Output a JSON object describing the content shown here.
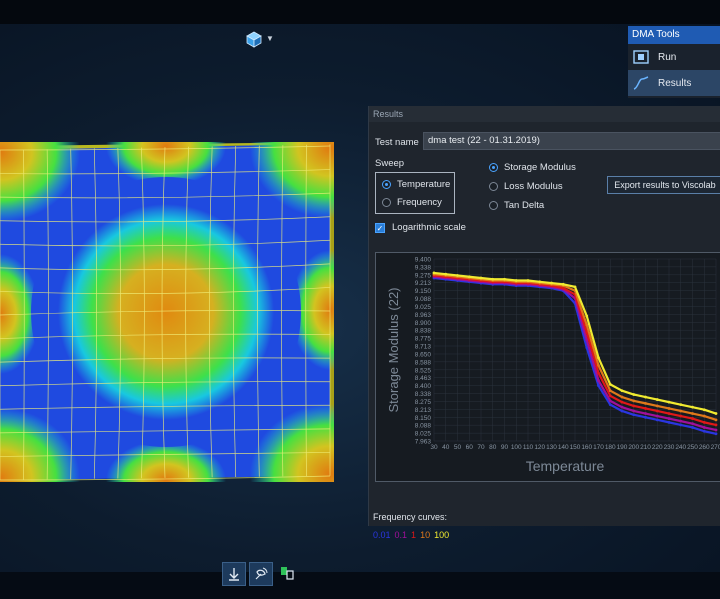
{
  "tools": {
    "title": "DMA Tools",
    "items": [
      {
        "label": "Run",
        "icon": "run-icon"
      },
      {
        "label": "Results",
        "icon": "results-curve-icon"
      }
    ]
  },
  "results": {
    "header": "Results",
    "test_name_label": "Test name",
    "test_name_value": "dma test (22 - 01.31.2019)",
    "sweep_label": "Sweep",
    "sweep_options": [
      "Temperature",
      "Frequency"
    ],
    "sweep_selected": "Temperature",
    "measure_options": [
      "Storage Modulus",
      "Loss Modulus",
      "Tan Delta"
    ],
    "measure_selected": "Storage Modulus",
    "export_label": "Export results to Viscolab",
    "log_scale_label": "Logarithmic scale",
    "log_scale_checked": true,
    "frequency_curves_label": "Frequency curves:",
    "frequency_values": [
      "0.01",
      "0.1",
      "1",
      "10",
      "100"
    ],
    "frequency_colors": [
      "#2a36e0",
      "#a0109a",
      "#e01818",
      "#e0781a",
      "#f0ea30"
    ]
  },
  "chart_data": {
    "type": "line",
    "xlabel": "Temperature",
    "ylabel": "Storage Modulus (22)",
    "x": [
      30,
      40,
      50,
      60,
      70,
      80,
      90,
      100,
      110,
      120,
      130,
      140,
      150,
      160,
      170,
      180,
      190,
      200,
      210,
      220,
      230,
      240,
      250,
      260,
      270
    ],
    "ylim": [
      7.963,
      9.4
    ],
    "yticks": [
      "9.400",
      "9.338",
      "9.275",
      "9.213",
      "9.150",
      "9.088",
      "9.025",
      "8.963",
      "8.900",
      "8.838",
      "8.775",
      "8.713",
      "8.650",
      "8.588",
      "8.525",
      "8.463",
      "8.400",
      "8.338",
      "8.275",
      "8.213",
      "8.150",
      "8.088",
      "8.025",
      "7.963"
    ],
    "series": [
      {
        "name": "0.01",
        "color": "#2a36e0",
        "values": [
          9.25,
          9.24,
          9.23,
          9.22,
          9.21,
          9.2,
          9.2,
          9.19,
          9.19,
          9.18,
          9.17,
          9.15,
          9.05,
          8.7,
          8.4,
          8.25,
          8.2,
          8.17,
          8.15,
          8.13,
          8.11,
          8.09,
          8.07,
          8.04,
          8.02
        ]
      },
      {
        "name": "0.1",
        "color": "#a0109a",
        "values": [
          9.26,
          9.25,
          9.24,
          9.23,
          9.22,
          9.21,
          9.21,
          9.2,
          9.2,
          9.19,
          9.18,
          9.16,
          9.09,
          8.76,
          8.44,
          8.28,
          8.23,
          8.2,
          8.18,
          8.16,
          8.14,
          8.12,
          8.1,
          8.07,
          8.05
        ]
      },
      {
        "name": "1",
        "color": "#e01818",
        "values": [
          9.27,
          9.26,
          9.25,
          9.24,
          9.23,
          9.22,
          9.22,
          9.21,
          9.21,
          9.2,
          9.19,
          9.17,
          9.12,
          8.82,
          8.5,
          8.32,
          8.27,
          8.24,
          8.22,
          8.2,
          8.18,
          8.16,
          8.14,
          8.11,
          8.09
        ]
      },
      {
        "name": "10",
        "color": "#e0781a",
        "values": [
          9.28,
          9.27,
          9.26,
          9.25,
          9.24,
          9.23,
          9.23,
          9.22,
          9.22,
          9.21,
          9.2,
          9.19,
          9.15,
          8.88,
          8.56,
          8.36,
          8.31,
          8.28,
          8.26,
          8.24,
          8.22,
          8.2,
          8.18,
          8.16,
          8.13
        ]
      },
      {
        "name": "100",
        "color": "#f0ea30",
        "values": [
          9.29,
          9.28,
          9.27,
          9.26,
          9.25,
          9.24,
          9.24,
          9.23,
          9.23,
          9.22,
          9.21,
          9.2,
          9.18,
          8.95,
          8.62,
          8.41,
          8.36,
          8.33,
          8.31,
          8.29,
          8.27,
          8.25,
          8.23,
          8.21,
          8.18
        ]
      }
    ],
    "grid": true
  }
}
